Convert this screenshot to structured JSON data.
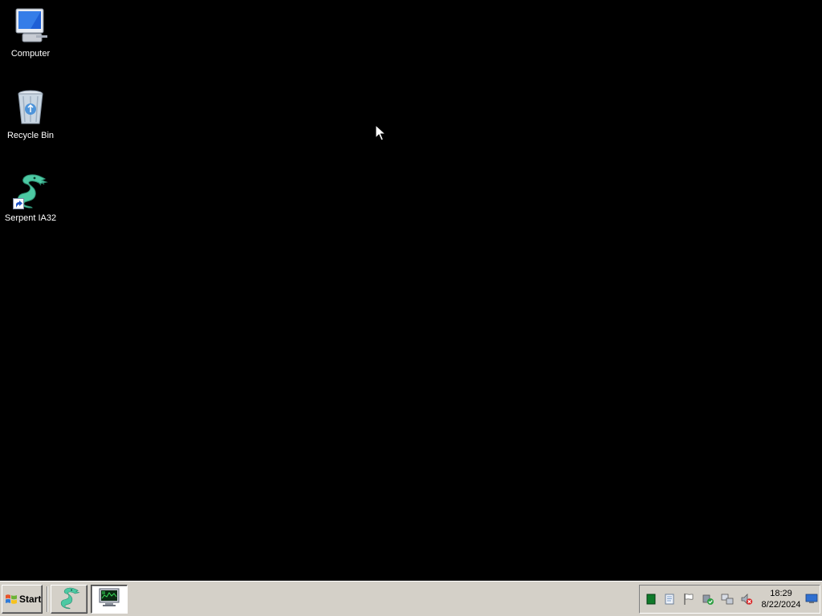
{
  "desktop": {
    "background": "#000000",
    "icons": [
      {
        "label": "Computer",
        "icon": "computer-icon"
      },
      {
        "label": "Recycle Bin",
        "icon": "recycle-bin-icon"
      },
      {
        "label": "Serpent IA32",
        "icon": "serpent-dragon-icon",
        "shortcut": true
      }
    ]
  },
  "taskbar": {
    "start_label": "Start",
    "buttons": [
      {
        "icon": "serpent-dragon-icon",
        "active": false
      },
      {
        "icon": "task-manager-monitor-icon",
        "active": true
      }
    ],
    "tray": {
      "icons": [
        "green-square-icon",
        "notepad-icon",
        "flag-icon",
        "security-shield-icon",
        "network-icon",
        "volume-muted-icon",
        "show-desktop-icon"
      ],
      "time": "18:29",
      "date": "8/22/2024"
    }
  },
  "colors": {
    "taskbar": "#d4d0c8",
    "accent_green": "#48c8a0"
  }
}
